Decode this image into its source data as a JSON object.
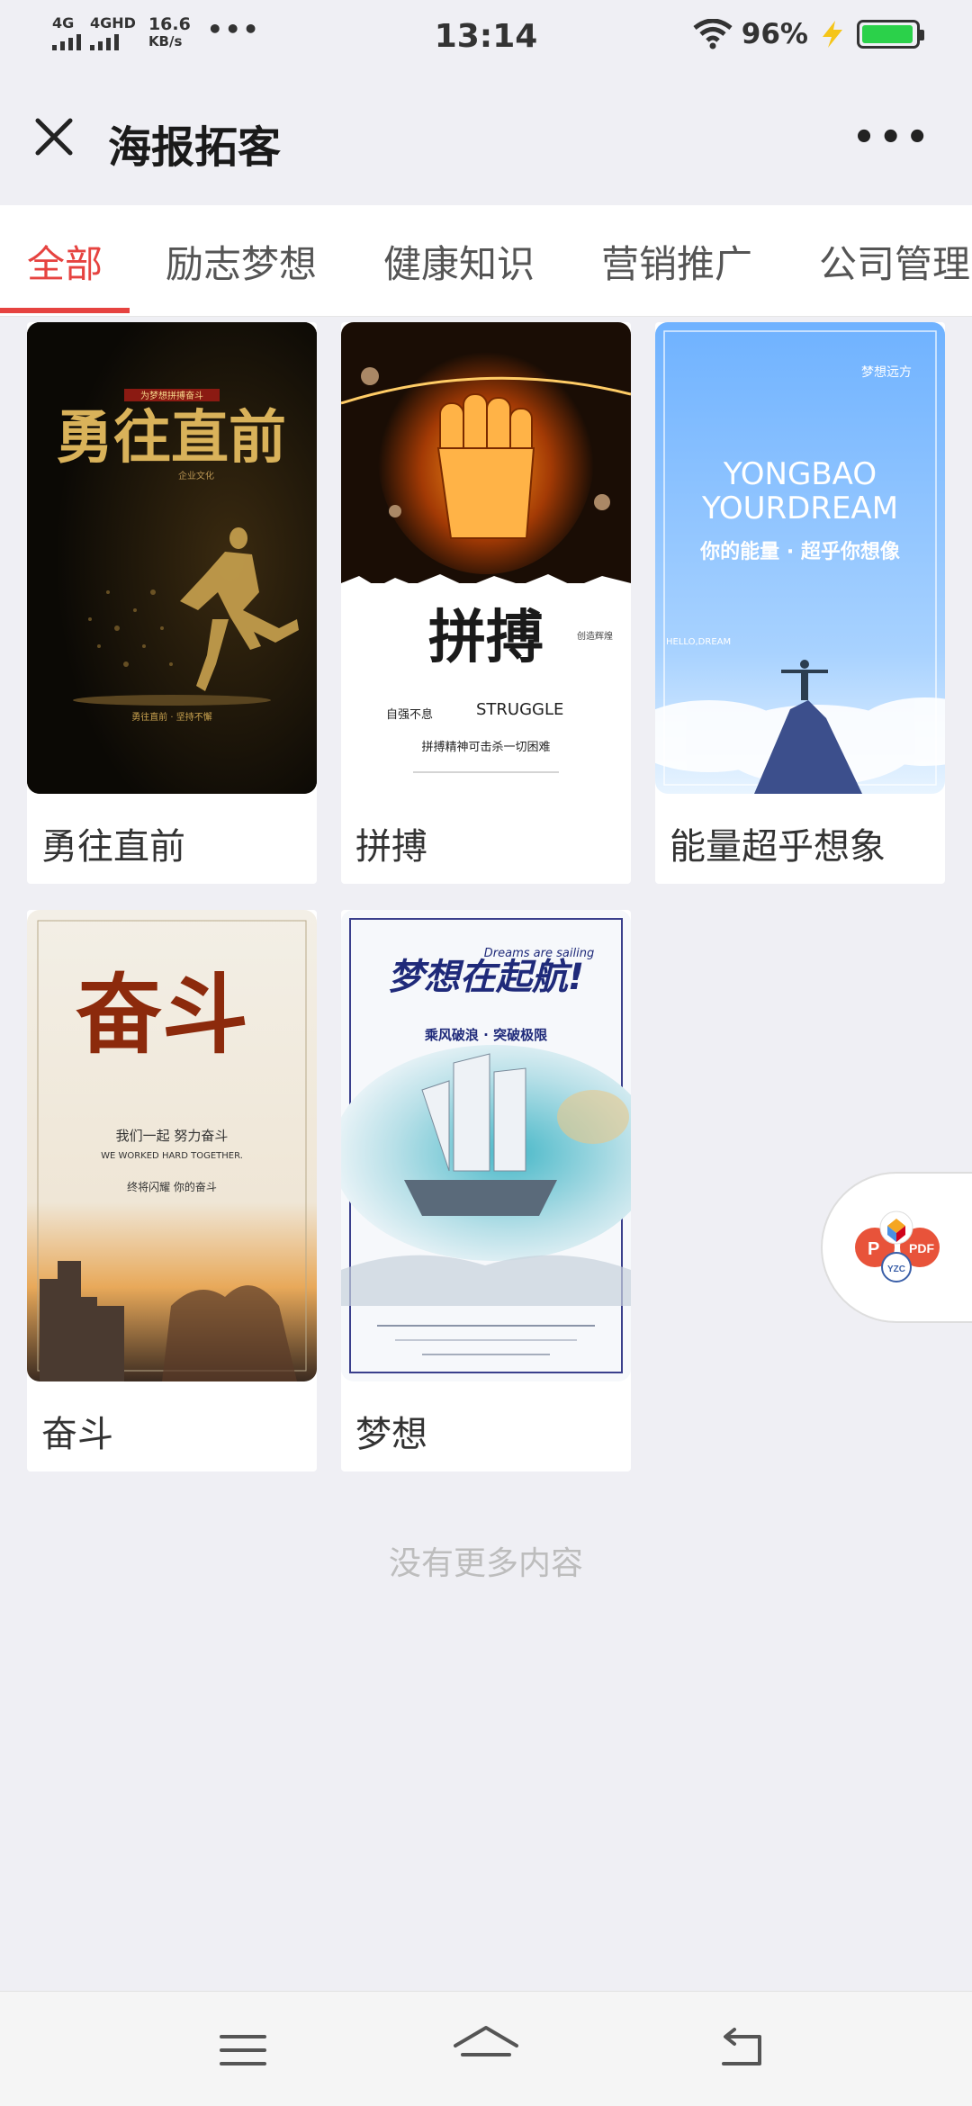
{
  "status": {
    "network1": "4G",
    "network2": "4GHD",
    "speed_value": "16.6",
    "speed_unit": "KB/s",
    "more": "•••",
    "time": "13:14",
    "battery_pct": "96%",
    "battery_level": 0.96
  },
  "header": {
    "title": "海报拓客",
    "more": "•••"
  },
  "tabs": [
    "全部",
    "励志梦想",
    "健康知识",
    "营销推广",
    "公司管理"
  ],
  "active_tab": 0,
  "posters": [
    {
      "caption": "勇往直前",
      "art": {
        "tag": "为梦想拼搏奋斗",
        "headline": "勇往直前",
        "small": "企业文化",
        "bottom": "勇往直前 · 坚持不懈"
      }
    },
    {
      "caption": "拼搏",
      "art": {
        "headline": "拼搏",
        "sub": "创造辉煌",
        "badge": "自强不息",
        "eng": "STRUGGLE",
        "line": "拼搏精神可击杀一切困难"
      }
    },
    {
      "caption": "能量超乎想象",
      "art": {
        "corner": "梦想远方",
        "eng1": "YONGBAO",
        "eng2": "YOURDREAM",
        "slogan": "你的能量 · 超乎你想像",
        "small": "HELLO,DREAM"
      }
    },
    {
      "caption": "奋斗",
      "art": {
        "headline": "奋斗",
        "line1": "我们一起 努力奋斗",
        "eng": "WE WORKED HARD TOGETHER.",
        "line2": "终将闪耀   你的奋斗"
      }
    },
    {
      "caption": "梦想",
      "art": {
        "headline": "梦想在起航!",
        "eng": "Dreams are sailing",
        "sub": "乘风破浪 · 突破极限"
      }
    }
  ],
  "end_text": "没有更多内容",
  "colors": {
    "accent": "#e64340",
    "background": "#efeff4"
  }
}
